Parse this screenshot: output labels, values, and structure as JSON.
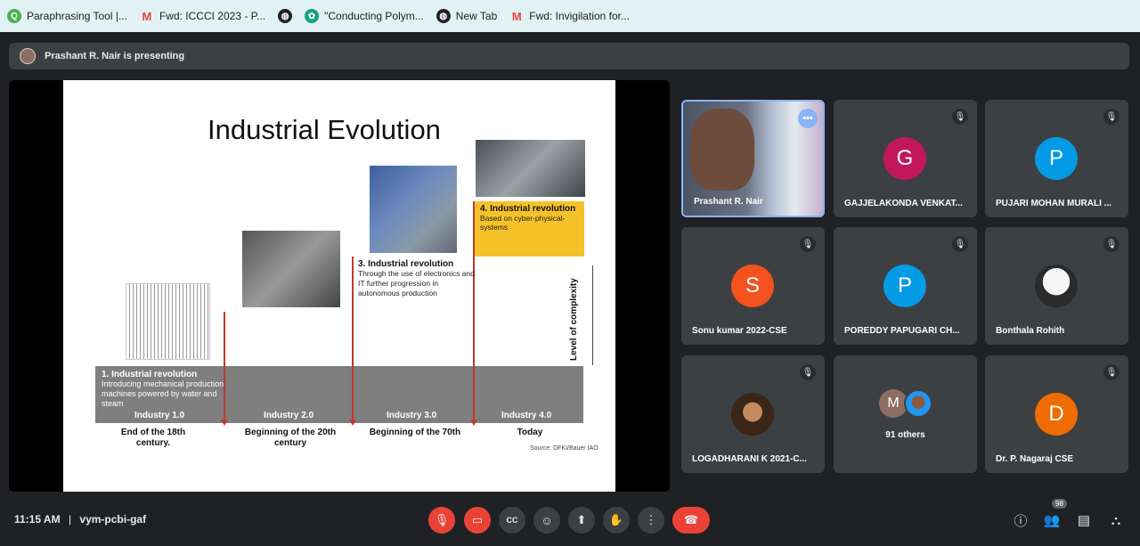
{
  "bookmarks": [
    {
      "label": "Paraphrasing Tool |...",
      "icon": "quillbot-icon",
      "color": "#4caf50"
    },
    {
      "label": "Fwd: ICCCI 2023 - P...",
      "icon": "gmail-icon",
      "color": "#ea4335"
    },
    {
      "label": "",
      "icon": "globe-icon",
      "color": "#202124"
    },
    {
      "label": "\"Conducting Polym...",
      "icon": "chatgpt-icon",
      "color": "#10a37f"
    },
    {
      "label": "New Tab",
      "icon": "globe-icon",
      "color": "#202124"
    },
    {
      "label": "Fwd: Invigilation for...",
      "icon": "gmail-icon",
      "color": "#ea4335"
    }
  ],
  "presenting": {
    "text": "Prashant R. Nair is presenting"
  },
  "slide": {
    "title": "Industrial Evolution",
    "rev1_title": "1. Industrial revolution",
    "rev1_text": "Introducing mechanical production machines powered by water and steam",
    "rev3_title": "3. Industrial revolution",
    "rev3_text": "Through the use of electronics and IT further progression in autonomous production",
    "rev4_title": "4. Industrial revolution",
    "rev4_text": "Based on cyber-physical-systems",
    "industries": [
      "Industry 1.0",
      "Industry 2.0",
      "Industry 3.0",
      "Industry 4.0"
    ],
    "eras": [
      "End of the 18th century.",
      "Beginning of the 20th century",
      "Beginning of the 70th",
      "Today"
    ],
    "axis_label": "Level of complexity",
    "source": "Source: DFKI/Bauer IAO"
  },
  "participants": [
    {
      "name": "Prashant R. Nair",
      "type": "video"
    },
    {
      "name": "GAJJELAKONDA VENKAT...",
      "initial": "G",
      "color": "#c2185b"
    },
    {
      "name": "PUJARI MOHAN MURALI ...",
      "initial": "P",
      "color": "#039be5"
    },
    {
      "name": "Sonu kumar 2022-CSE",
      "initial": "S",
      "color": "#f4511e"
    },
    {
      "name": "POREDDY PAPUGARI CH...",
      "initial": "P",
      "color": "#039be5"
    },
    {
      "name": "Bonthala Rohith",
      "type": "photo"
    },
    {
      "name": "LOGADHARANI K 2021-C...",
      "type": "photo"
    },
    {
      "name": "91 others",
      "initial": "M",
      "color": "#8d6e63"
    },
    {
      "name": "Dr. P. Nagaraj CSE",
      "initial": "D",
      "color": "#ef6c00"
    }
  ],
  "bottom": {
    "time": "11:15 AM",
    "separator": "|",
    "meeting_code": "vym-pcbi-gaf",
    "people_count": "98"
  }
}
